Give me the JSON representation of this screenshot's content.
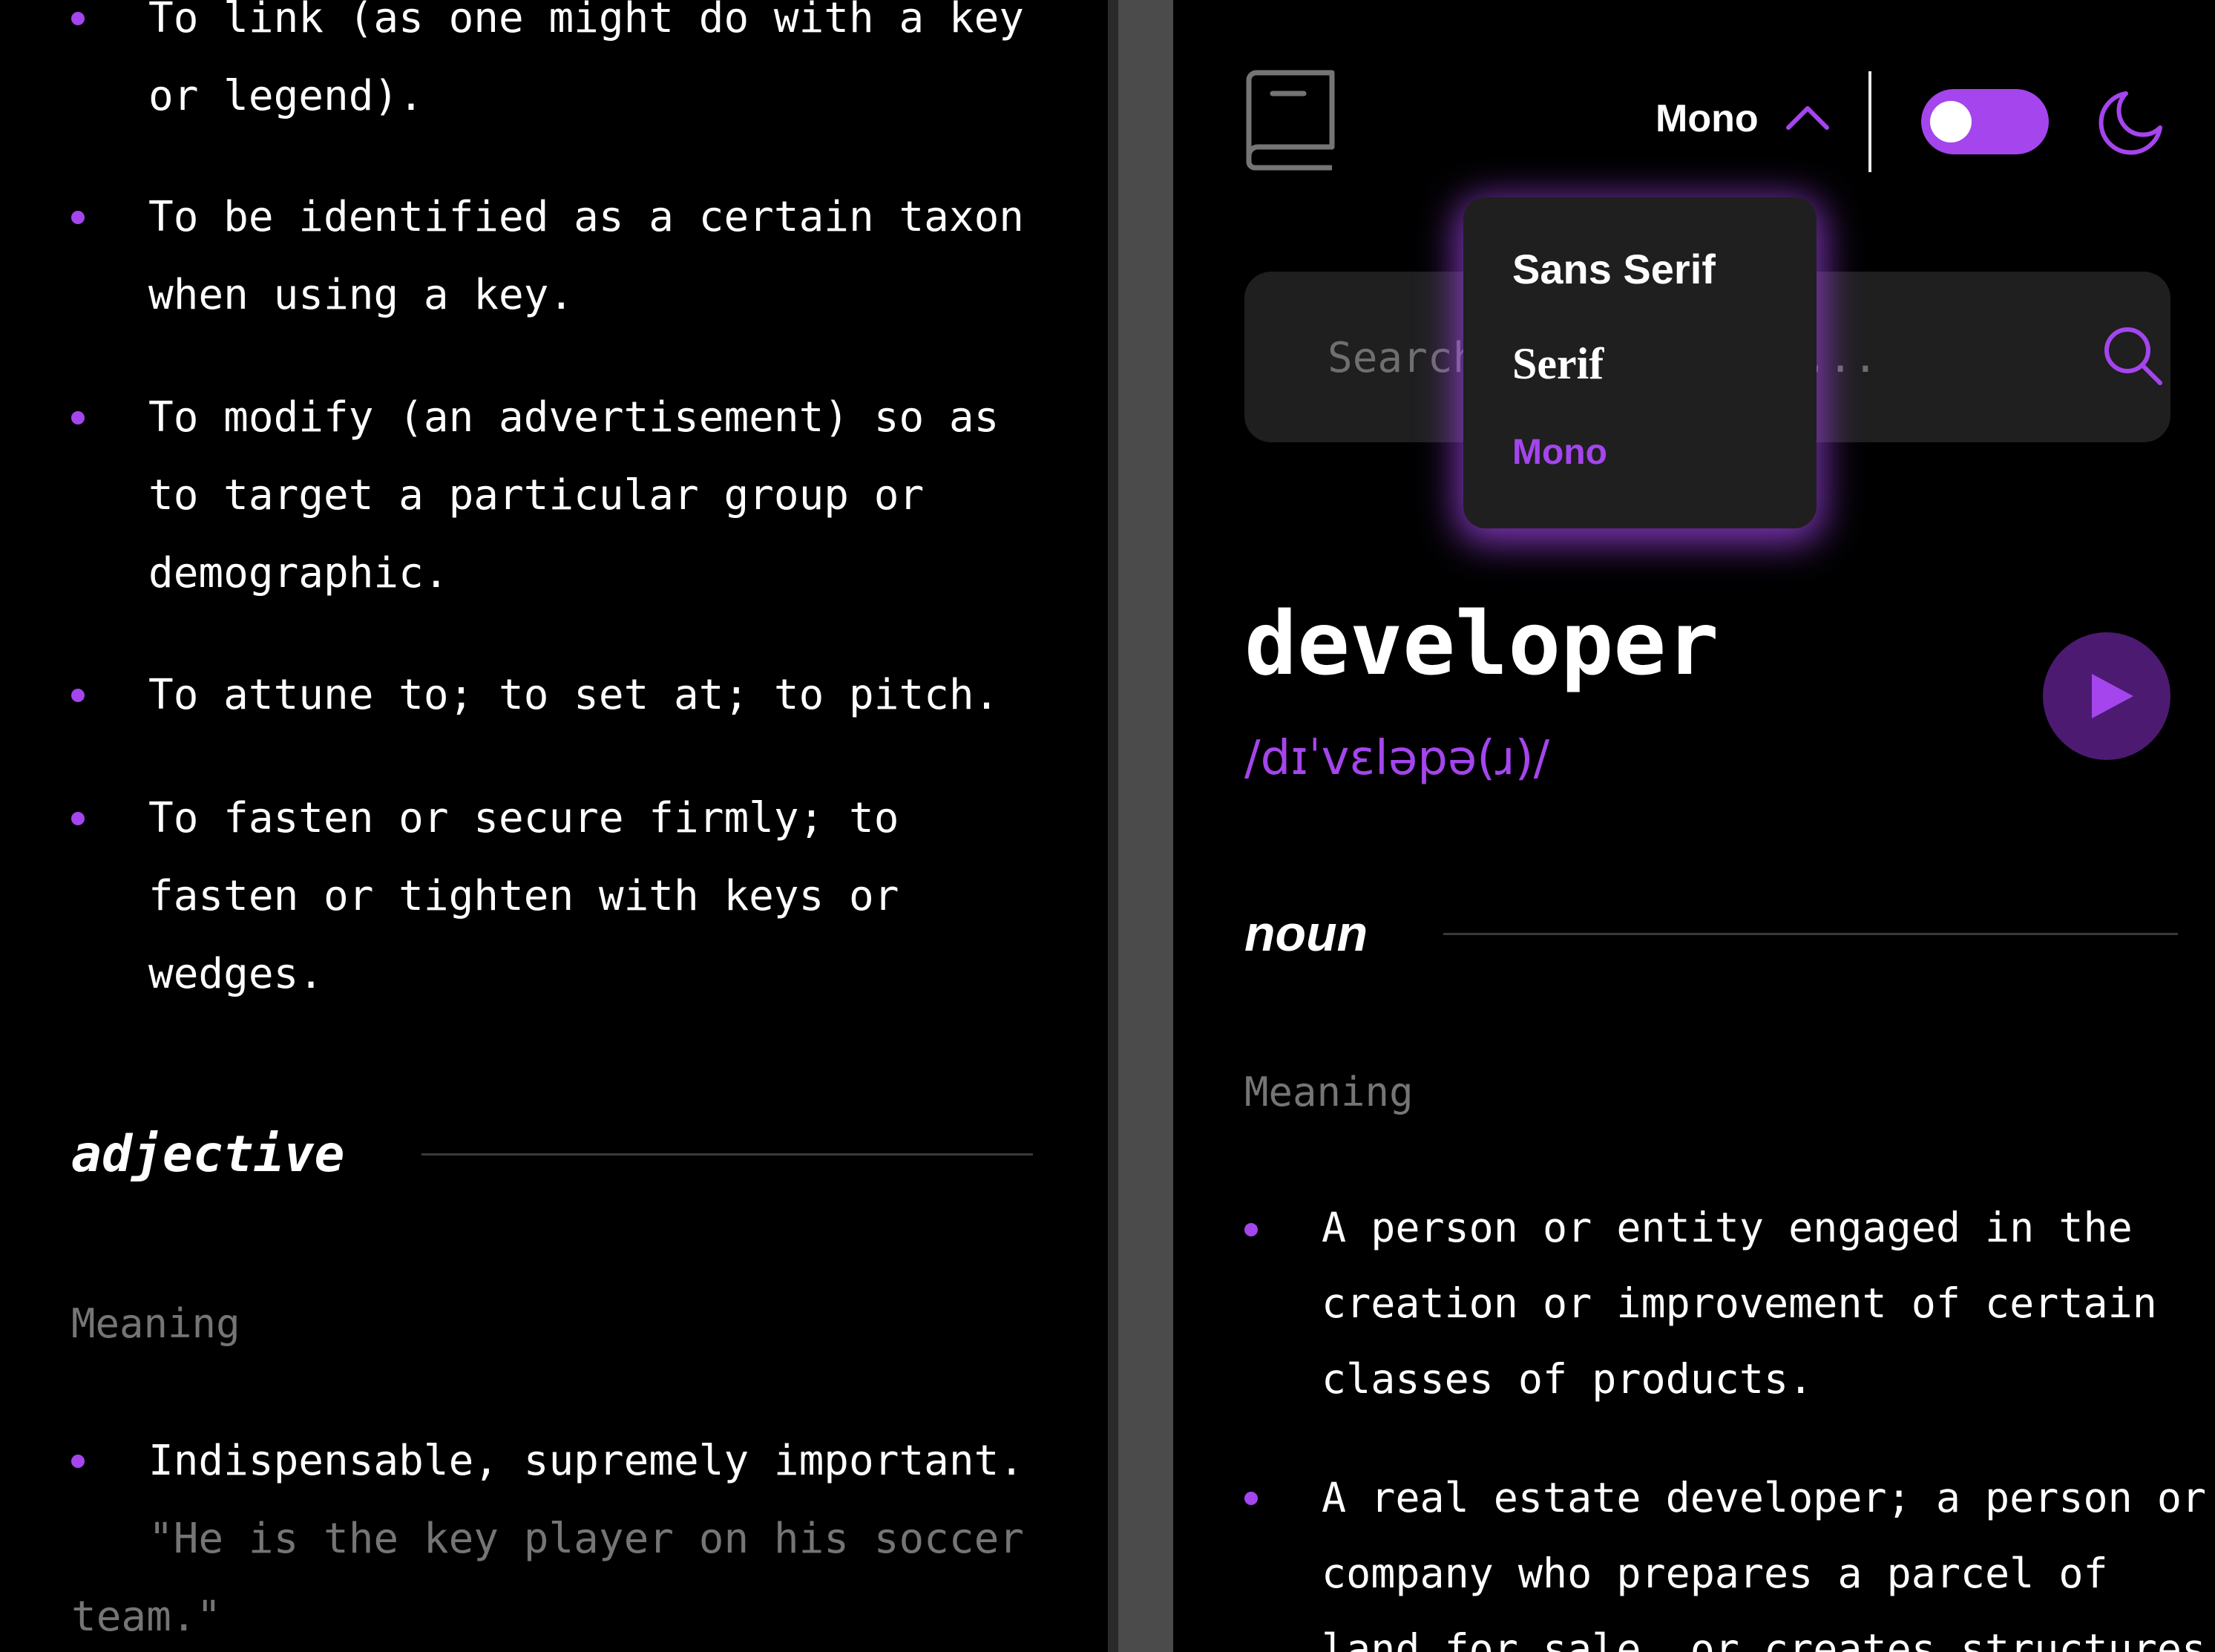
{
  "left_panel": {
    "top_items": [
      "To link (as one might do with a key or legend).",
      "To be identified as a certain taxon when using a key.",
      "To modify (an advertisement) so as to target a particular group or demographic.",
      "To attune to; to set at; to pitch.",
      "To fasten or secure firmly; to fasten or tighten with keys or wedges."
    ],
    "top_lines": [
      [
        "To link (as one might do with a key",
        "or legend)."
      ],
      [
        "To be identified as a certain taxon",
        "when using a key."
      ],
      [
        "To modify (an advertisement) so as",
        "to target a particular group or",
        "demographic."
      ],
      [
        "To attune to; to set at; to pitch."
      ],
      [
        "To fasten or secure firmly; to",
        "fasten or tighten with keys or",
        "wedges."
      ]
    ],
    "adjective": {
      "label": "adjective",
      "meaning_label": "Meaning",
      "definition": "Indispensable, supremely important.",
      "example_line1": "\"He is the key player on his soccer",
      "example_line2": "team.\""
    }
  },
  "header": {
    "font_selected": "Mono",
    "dark_mode": true
  },
  "font_dropdown": {
    "options": [
      "Sans Serif",
      "Serif",
      "Mono"
    ],
    "selected": "Mono"
  },
  "search": {
    "placeholder": "Search for any word...",
    "value": ""
  },
  "entry": {
    "word": "developer",
    "phonetic": "/dɪˈvɛləpə(ɹ)/",
    "part_of_speech": "noun",
    "meaning_label": "Meaning",
    "definitions": [
      [
        "A person or entity engaged in the",
        "creation or improvement of certain",
        "classes of products."
      ],
      [
        "A real estate developer; a person or",
        "company who prepares a parcel of",
        "land for sale, or creates structures"
      ]
    ]
  },
  "colors": {
    "accent": "#a445ed",
    "background": "#000000",
    "surface": "#1f1f1f",
    "muted_text": "#757575",
    "play_bg": "#4d1a72"
  }
}
